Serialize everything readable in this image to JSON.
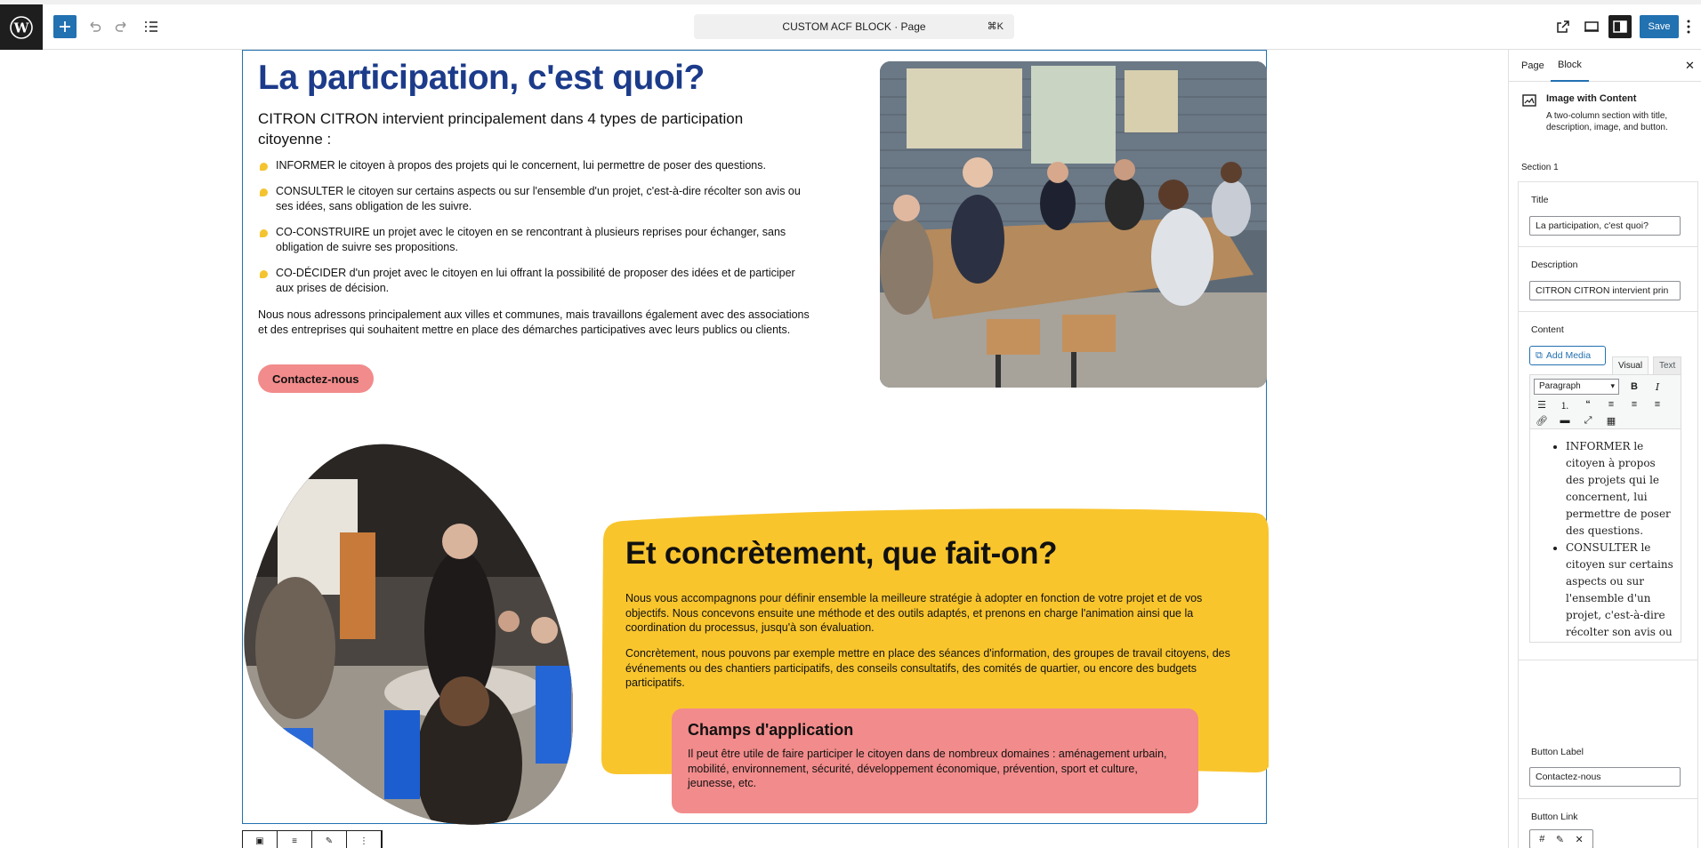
{
  "topbar": {
    "document_title": "CUSTOM ACF BLOCK · Page",
    "shortcut": "⌘K",
    "save_label": "Save"
  },
  "content": {
    "title": "La participation, c'est quoi?",
    "lead": "CITRON CITRON intervient principalement dans 4 types de participation citoyenne :",
    "bullets": [
      "INFORMER le citoyen à propos des projets qui le concernent, lui permettre de poser des questions.",
      "CONSULTER le citoyen sur certains aspects ou sur l'ensemble d'un projet, c'est-à-dire récolter son avis ou ses idées, sans obligation de les suivre.",
      "CO-CONSTRUIRE un projet avec le citoyen en se rencontrant à plusieurs reprises pour échanger, sans obligation de suivre ses propositions.",
      "CO-DÉCIDER d'un projet avec le citoyen en lui offrant la possibilité de proposer des idées et de participer aux prises de décision."
    ],
    "paragraph": "Nous nous adressons principalement aux villes et communes, mais travaillons également avec des associations et des entreprises qui souhaitent mettre en place des démarches participatives avec leurs publics ou clients.",
    "button_label": "Contactez-nous",
    "section2_title": "Et concrètement, que fait-on?",
    "section2_p1": "Nous vous accompagnons pour définir ensemble la meilleure stratégie à adopter en fonction de votre projet et de vos objectifs. Nous concevons ensuite une méthode et des outils adaptés, et prenons en charge l'animation ainsi que la coordination du processus, jusqu'à son évaluation.",
    "section2_p2": "Concrètement, nous pouvons par exemple mettre en place des séances d'information, des groupes de travail citoyens, des événements ou des chantiers participatifs, des conseils consultatifs, des comités de quartier, ou encore des budgets participatifs.",
    "callout_title": "Champs d'application",
    "callout_text": "Il peut être utile de faire participer le citoyen dans de nombreux domaines : aménagement urbain, mobilité, environnement, sécurité, développement économique, prévention, sport et culture, jeunesse, etc."
  },
  "sidebar": {
    "tab_page": "Page",
    "tab_block": "Block",
    "block_name": "Image with Content",
    "block_desc": "A two-column section with title, description, image, and button.",
    "section_label": "Section 1",
    "title_label": "Title",
    "title_value": "La participation, c'est quoi?",
    "description_label": "Description",
    "description_value": "CITRON CITRON intervient prin",
    "content_label": "Content",
    "add_media": "Add Media",
    "tab_visual": "Visual",
    "tab_text": "Text",
    "format_select": "Paragraph",
    "editor_items": [
      "INFORMER le citoyen à propos des projets qui le concernent, lui permettre de poser des questions.",
      "CONSULTER le citoyen sur certains aspects ou sur l'ensemble d'un projet, c'est-à-dire récolter son avis ou ses idées, sans"
    ],
    "button_label_label": "Button Label",
    "button_label_value": "Contactez-nous",
    "button_link_label": "Button Link",
    "button_link_value": "#"
  },
  "colors": {
    "accent": "#2271b1",
    "title_blue": "#1c3b8a",
    "yellow": "#f9c52d",
    "pink": "#f28b8b"
  }
}
